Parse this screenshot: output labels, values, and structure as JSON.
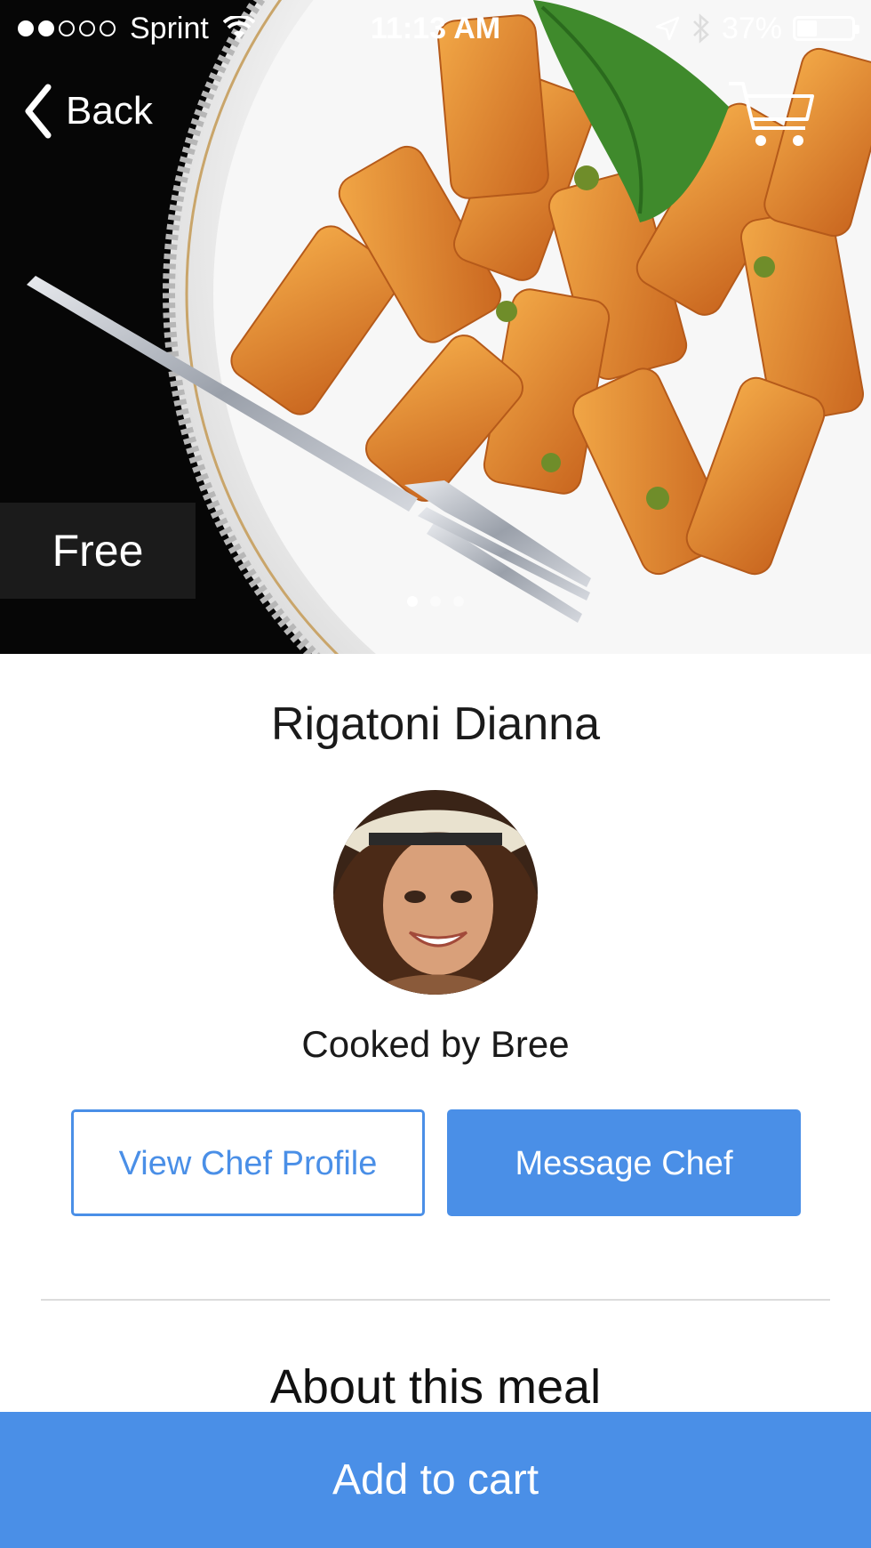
{
  "status_bar": {
    "signal_bars_on": 2,
    "signal_bars_total": 5,
    "carrier": "Sprint",
    "time": "11:13 AM",
    "battery_percent": "37%",
    "battery_level": 0.37,
    "icons": [
      "wifi-icon",
      "location-arrow-icon",
      "bluetooth-icon",
      "battery-icon"
    ]
  },
  "nav": {
    "back_label": "Back",
    "cart_icon": "cart-icon"
  },
  "hero": {
    "price_label": "Free",
    "page_count": 3,
    "active_page": 1
  },
  "meal": {
    "title": "Rigatoni Dianna",
    "chef_line": "Cooked by Bree"
  },
  "actions": {
    "view_profile_label": "View Chef Profile",
    "message_label": "Message Chef"
  },
  "about": {
    "heading": "About this meal"
  },
  "footer": {
    "add_to_cart_label": "Add to cart"
  },
  "colors": {
    "accent": "#4a8fe7",
    "badge_bg": "#1b1b1b"
  }
}
